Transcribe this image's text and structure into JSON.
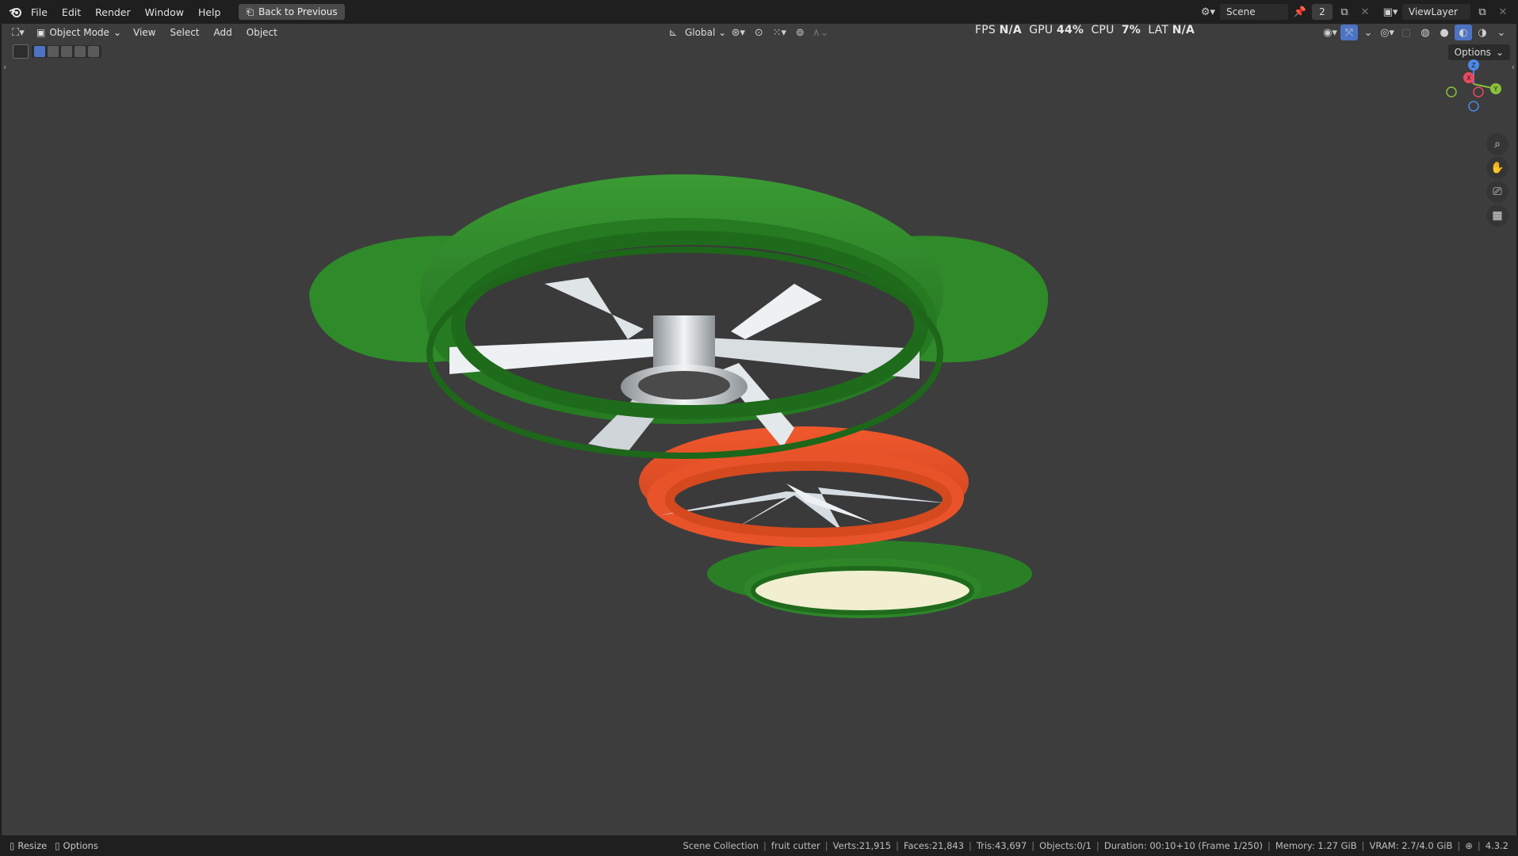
{
  "menu": {
    "items": [
      "File",
      "Edit",
      "Render",
      "Window",
      "Help"
    ],
    "back_label": "Back to Previous"
  },
  "top_right": {
    "scene": "Scene",
    "scene_users": "2",
    "view_layer": "ViewLayer"
  },
  "viewport_header": {
    "mode": "Object Mode",
    "menus": [
      "View",
      "Select",
      "Add",
      "Object"
    ],
    "orientation": "Global",
    "options_label": "Options"
  },
  "perf": {
    "fps_label": "FPS",
    "fps_value": "N/A",
    "gpu_label": "GPU",
    "gpu_value": "44",
    "cpu_label": "CPU",
    "cpu_value": "7",
    "lat_label": "LAT",
    "lat_value": "N/A",
    "percent": "%"
  },
  "gizmo": {
    "x": "X",
    "y": "Y",
    "z": "Z"
  },
  "status": {
    "left": [
      "Resize",
      "Options"
    ],
    "collection": "Scene Collection",
    "object": "fruit cutter",
    "verts": "Verts:21,915",
    "faces": "Faces:21,843",
    "tris": "Tris:43,697",
    "objects": "Objects:0/1",
    "duration": "Duration: 00:10+10 (Frame 1/250)",
    "memory": "Memory: 1.27 GiB",
    "vram": "VRAM: 2.7/4.0 GiB",
    "version": "4.3.2"
  },
  "colors": {
    "green": "#2f8a2a",
    "orange": "#e8532a",
    "blade": "#d8dde0",
    "background": "#3d3d3d"
  }
}
